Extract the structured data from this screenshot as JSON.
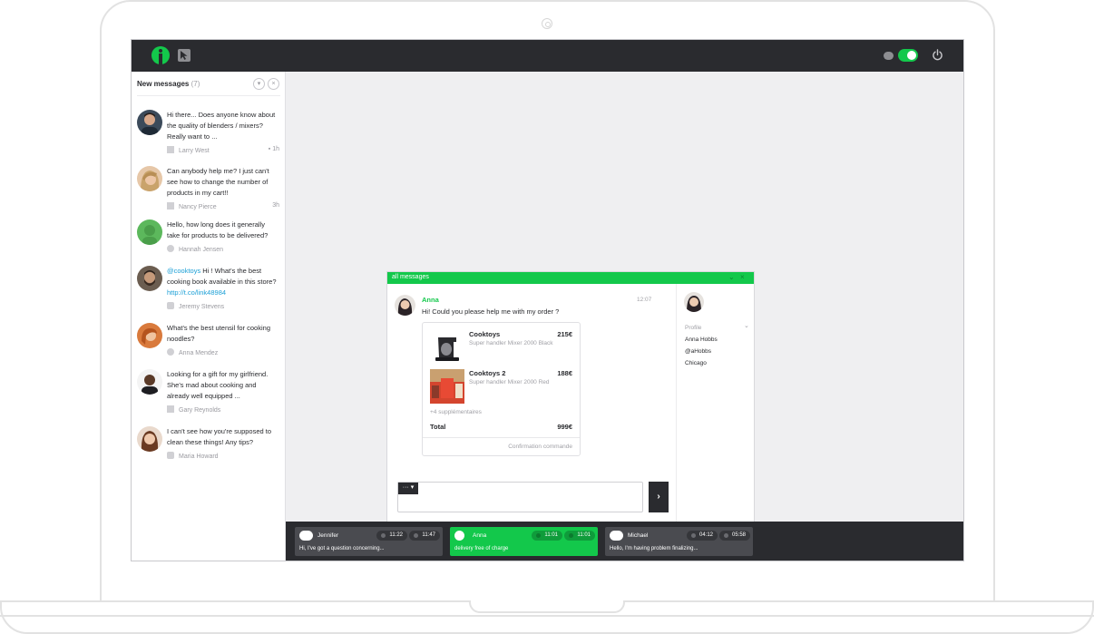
{
  "sidebar": {
    "title": "New messages",
    "count": "(7)",
    "messages": [
      {
        "text": "Hi there... Does anyone know about the quality of blenders / mixers? Really want to ...",
        "author": "Larry West",
        "source": "facebook-icon",
        "time": "1h"
      },
      {
        "text": "Can anybody help me? I just can't see how to change the number of products in my cart!!",
        "author": "Nancy Pierce",
        "source": "facebook-icon",
        "time": "3h"
      },
      {
        "text": "Hello, how long does it generally take for products to be delivered?",
        "author": "Hannah Jensen",
        "source": "chat-icon",
        "time": ""
      },
      {
        "mention": "@cooktoys",
        "text": " Hi ! What's the best cooking book available in this store? ",
        "link": "http://t.co/link48984",
        "author": "Jeremy Stevens",
        "source": "twitter-icon",
        "time": ""
      },
      {
        "text": "What's the best utensil for cooking noodles?",
        "author": "Anna Mendez",
        "source": "chat-icon",
        "time": ""
      },
      {
        "text": "Looking for a gift for my girlfriend. She's mad about cooking and already well equipped ...",
        "author": "Gary Reynolds",
        "source": "facebook-icon",
        "time": ""
      },
      {
        "text": "I can't see how you're supposed to clean these things! Any tips?",
        "author": "Maria Howard",
        "source": "twitter-icon",
        "time": ""
      }
    ]
  },
  "chat": {
    "bar_title": "all messages",
    "name": "Anna",
    "time": "12:07",
    "message": "Hi! Could you please help me with my order ?",
    "products": [
      {
        "name": "Cooktoys",
        "price": "215€",
        "desc": "Super handler Mixer 2000 Black"
      },
      {
        "name": "Cooktoys 2",
        "price": "188€",
        "desc": "Super handler Mixer 2000 Red"
      }
    ],
    "more": "+4 supplémentaires",
    "total_label": "Total",
    "total_value": "999€",
    "confirm": "Confirmation commande",
    "more_button": "··· ▾",
    "send_button": "›"
  },
  "profile": {
    "label": "Profile",
    "name": "Anna Hobbs",
    "handle": "@aHobbs",
    "city": "Chicago"
  },
  "tray": [
    {
      "name": "Jennifer",
      "t1": "11:22",
      "t2": "11:47",
      "preview": "Hi, I've got a question concerning..."
    },
    {
      "name": "Anna",
      "t1": "11:01",
      "t2": "11:01",
      "preview": "delivery free of charge"
    },
    {
      "name": "Michael",
      "t1": "04:12",
      "t2": "05:58",
      "preview": "Hello, I'm having problem finalizing..."
    }
  ],
  "colors": {
    "accent": "#13c84b",
    "dark": "#2a2b2f",
    "link": "#1a9fd6"
  }
}
